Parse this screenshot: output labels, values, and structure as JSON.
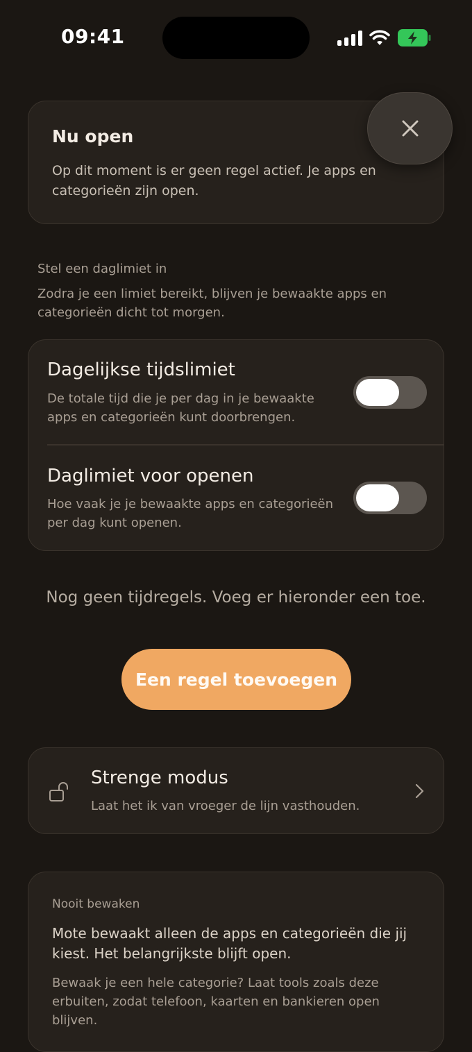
{
  "status_bar": {
    "time": "09:41"
  },
  "open_card": {
    "title": "Nu open",
    "description": "Op dit moment is er geen regel actief. Je apps en categorieën zijn open."
  },
  "daily_limit_section": {
    "title": "Stel een daglimiet in",
    "description": "Zodra je een limiet bereikt, blijven je bewaakte apps en categorieën dicht tot morgen."
  },
  "limits": [
    {
      "title": "Dagelijkse tijdslimiet",
      "description": "De totale tijd die je per dag in je bewaakte apps en categorieën kunt doorbrengen.",
      "enabled": false
    },
    {
      "title": "Daglimiet voor openen",
      "description": "Hoe vaak je je bewaakte apps en categorieën per dag kunt openen.",
      "enabled": false
    }
  ],
  "empty_state": "Nog geen tijdregels. Voeg er hieronder een toe.",
  "add_rule_label": "Een regel toevoegen",
  "strict_mode": {
    "title": "Strenge modus",
    "description": "Laat het ik van vroeger de lijn vasthouden."
  },
  "never_guard": {
    "title": "Nooit bewaken",
    "paragraph1": "Mote bewaakt alleen de apps en categorieën die jij kiest. Het belangrijkste blijft open.",
    "paragraph2": "Bewaak je een hele categorie? Laat tools zoals deze erbuiten, zodat telefoon, kaarten en bankieren open blijven."
  },
  "colors": {
    "background": "#1b1713",
    "card": "#26211c",
    "accent": "#f0a862",
    "battery": "#34c759"
  }
}
